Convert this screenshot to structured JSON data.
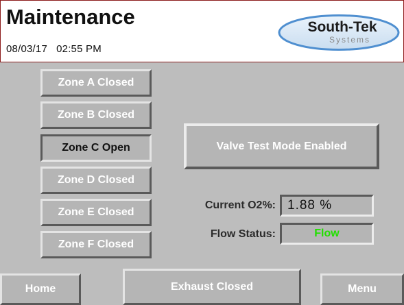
{
  "header": {
    "title": "Maintenance",
    "date": "08/03/17",
    "time": "02:55 PM",
    "logo_line1": "South-Tek",
    "logo_line2": "Systems"
  },
  "zones": [
    {
      "label": "Zone A Closed",
      "state": "closed"
    },
    {
      "label": "Zone B Closed",
      "state": "closed"
    },
    {
      "label": "Zone C Open",
      "state": "open"
    },
    {
      "label": "Zone D Closed",
      "state": "closed"
    },
    {
      "label": "Zone E Closed",
      "state": "closed"
    },
    {
      "label": "Zone F Closed",
      "state": "closed"
    }
  ],
  "mode": {
    "label": "Valve Test Mode Enabled"
  },
  "readings": {
    "o2_label": "Current O2%:",
    "o2_value": "1.88 %",
    "flow_label": "Flow Status:",
    "flow_value": "Flow",
    "flow_color": "#22e000"
  },
  "footer": {
    "home_label": "Home",
    "exhaust_label": "Exhaust Closed",
    "menu_label": "Menu"
  },
  "colors": {
    "panel_bg": "#bdbdbd",
    "header_border": "#8b1a1a",
    "logo_blue": "#4f8fd0"
  }
}
